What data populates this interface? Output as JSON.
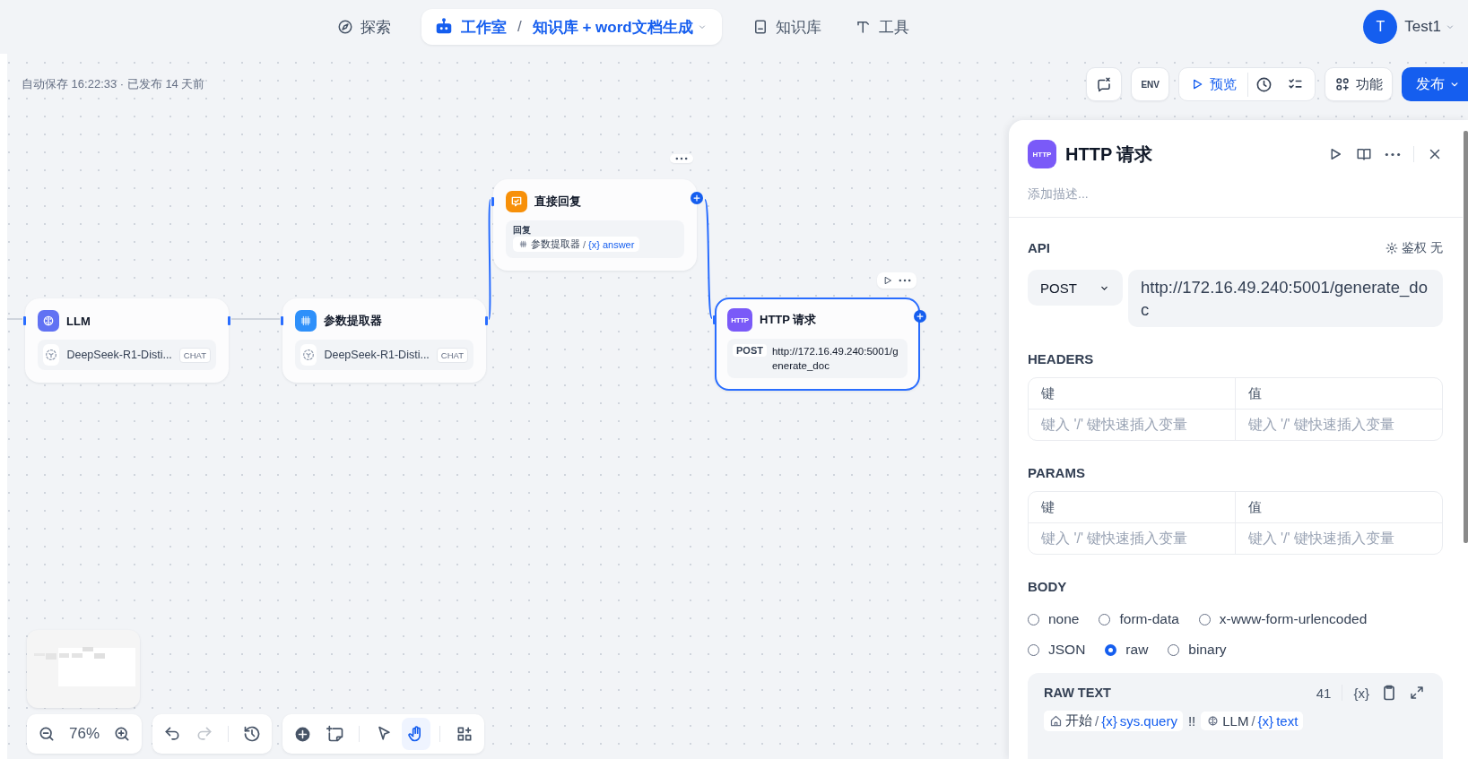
{
  "nav": {
    "items": [
      {
        "kind": "link",
        "label": "探索",
        "selected": false
      },
      {
        "kind": "app",
        "label": "工作室",
        "sep": "/",
        "app_name": "知识库 + word文档生成",
        "selected": true
      },
      {
        "kind": "link",
        "label": "知识库",
        "selected": false
      },
      {
        "kind": "link",
        "label": "工具",
        "selected": false
      }
    ]
  },
  "user": {
    "avatar_letter": "T",
    "name": "Test1"
  },
  "status": "自动保存 16:22:33 · 已发布 14 天前",
  "toolbar": {
    "env": "ENV",
    "preview": "预览",
    "features": "功能",
    "publish": "发布"
  },
  "nodes": [
    {
      "kind": "llm",
      "title": "LLM",
      "model": "DeepSeek-R1-Disti...",
      "tag": "CHAT",
      "selected": false,
      "show_menu": false
    },
    {
      "kind": "extractor",
      "title": "参数提取器",
      "model": "DeepSeek-R1-Disti...",
      "tag": "CHAT",
      "selected": false,
      "show_menu": false
    },
    {
      "kind": "answer",
      "title": "直接回复",
      "label": "回复",
      "ref": {
        "node": "参数提取器",
        "sep": "/",
        "var_mark": "{x}",
        "var": "answer"
      },
      "selected": false,
      "show_menu": true
    },
    {
      "kind": "http",
      "title": "HTTP 请求",
      "icon_text": "HTTP",
      "method": "POST",
      "url": "http://172.16.49.240:5001/generate_doc",
      "selected": true,
      "show_menu": true
    }
  ],
  "panel": {
    "icon_text": "HTTP",
    "title": "HTTP 请求",
    "description": {
      "placeholder": "添加描述..."
    },
    "api": {
      "label": "API",
      "auth_label": "鉴权",
      "auth_value": "无",
      "method": "POST",
      "url": "http://172.16.49.240:5001/generate_doc"
    },
    "headers": {
      "label": "HEADERS",
      "key_col": "键",
      "value_col": "值",
      "key_placeholder": "键入 '/' 键快速插入变量",
      "value_placeholder": "键入 '/' 键快速插入变量"
    },
    "params": {
      "label": "PARAMS",
      "key_col": "键",
      "value_col": "值",
      "key_placeholder": "键入 '/' 键快速插入变量",
      "value_placeholder": "键入 '/' 键快速插入变量"
    },
    "body": {
      "label": "BODY",
      "options": [
        {
          "label": "none",
          "selected": false
        },
        {
          "label": "form-data",
          "selected": false
        },
        {
          "label": "x-www-form-urlencoded",
          "selected": false
        },
        {
          "label": "JSON",
          "selected": false
        },
        {
          "label": "raw",
          "selected": true
        },
        {
          "label": "binary",
          "selected": false
        }
      ],
      "raw": {
        "label": "RAW TEXT",
        "count": "41",
        "var_button": "{x}",
        "content": [
          {
            "kind": "ref",
            "node": "开始",
            "sep": "/",
            "var_mark": "{x}",
            "var": "sys.query"
          },
          {
            "kind": "text",
            "text": "!!"
          },
          {
            "kind": "ref",
            "node": "LLM",
            "sep": "/",
            "var_mark": "{x}",
            "var": "text"
          }
        ]
      }
    }
  },
  "zoom": "76%",
  "undo": {
    "disabled": false
  },
  "redo": {
    "disabled": true
  },
  "canvas_tools": [
    {
      "kind": "pointer",
      "selected": false
    },
    {
      "kind": "hand",
      "selected": true
    }
  ]
}
